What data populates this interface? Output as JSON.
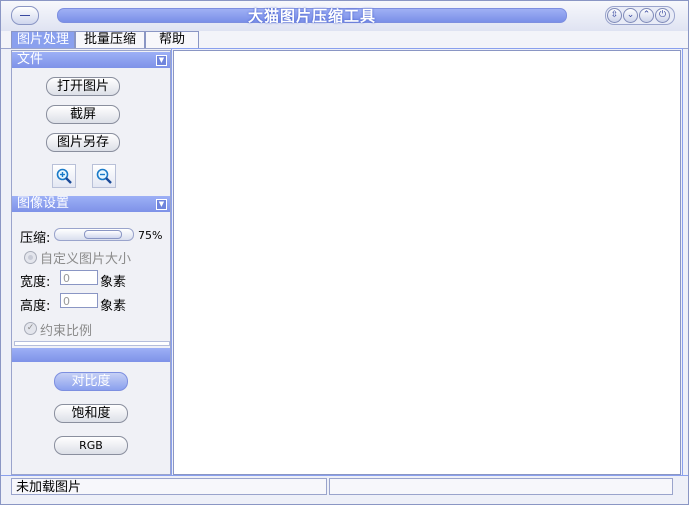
{
  "window": {
    "title": "大猫图片压缩工具"
  },
  "menu": {
    "items": [
      {
        "label": "图片处理"
      },
      {
        "label": "批量压缩"
      },
      {
        "label": "帮助"
      }
    ]
  },
  "file_section": {
    "title": "文件",
    "open_label": "打开图片",
    "screenshot_label": "截屏",
    "save_as_label": "图片另存"
  },
  "image_settings": {
    "title": "图像设置",
    "compress_label": "压缩:",
    "compress_value": "75%",
    "compress_level": 0.75,
    "custom_size_label": "自定义图片大小",
    "width_label": "宽度:",
    "width_value": "0",
    "height_label": "高度:",
    "height_value": "0",
    "unit_label": "象素",
    "constrain_label": "约束比例"
  },
  "adjust": {
    "contrast_label": "对比度",
    "saturation_label": "饱和度",
    "rgb_label": "RGB"
  },
  "status": {
    "message": "未加载图片",
    "secondary": ""
  },
  "icons": {
    "zoom_in": "zoom-in-icon",
    "zoom_out": "zoom-out-icon"
  },
  "colors": {
    "accent": "#8aa0ee",
    "header": "#7e92e8"
  }
}
